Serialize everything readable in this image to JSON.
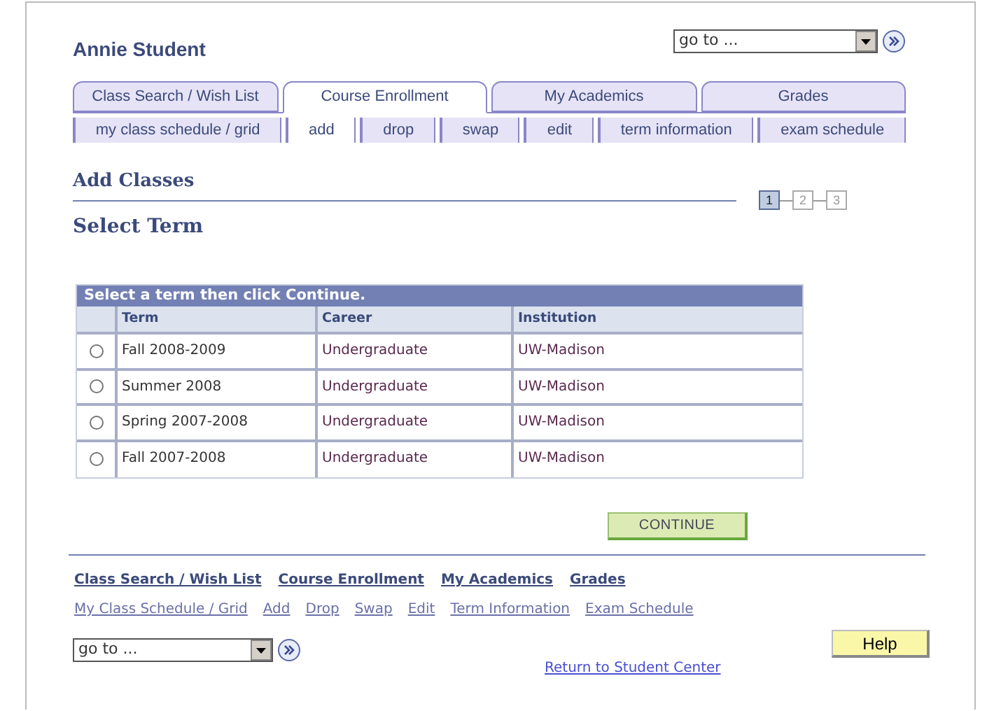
{
  "user_name": "Annie Student",
  "goto_top": {
    "value": "go to ..."
  },
  "tabs": [
    {
      "label": "Class Search / Wish List",
      "selected": false
    },
    {
      "label": "Course Enrollment",
      "selected": true
    },
    {
      "label": "My Academics",
      "selected": false
    },
    {
      "label": "Grades",
      "selected": false
    }
  ],
  "subtabs": [
    {
      "label": "my class schedule / grid",
      "selected": false
    },
    {
      "label": "add",
      "selected": true
    },
    {
      "label": "drop",
      "selected": false
    },
    {
      "label": "swap",
      "selected": false
    },
    {
      "label": "edit",
      "selected": false
    },
    {
      "label": "term information",
      "selected": false
    },
    {
      "label": "exam schedule",
      "selected": false
    }
  ],
  "page_title": "Add Classes",
  "steps": [
    {
      "label": "1",
      "selected": true
    },
    {
      "label": "2",
      "selected": false
    },
    {
      "label": "3",
      "selected": false
    }
  ],
  "section_title": "Select Term",
  "table": {
    "caption": "Select a term then click Continue.",
    "columns": [
      "Term",
      "Career",
      "Institution"
    ],
    "rows": [
      {
        "selected": false,
        "cells": [
          "Fall 2008-2009",
          "Undergraduate",
          "UW-Madison"
        ]
      },
      {
        "selected": false,
        "cells": [
          "Summer 2008",
          "Undergraduate",
          "UW-Madison"
        ]
      },
      {
        "selected": false,
        "cells": [
          "Spring 2007-2008",
          "Undergraduate",
          "UW-Madison"
        ]
      },
      {
        "selected": false,
        "cells": [
          "Fall 2007-2008",
          "Undergraduate",
          "UW-Madison"
        ]
      }
    ]
  },
  "continue_button": "CONTINUE",
  "footer_links": [
    "Class Search / Wish List",
    "Course Enrollment",
    "My Academics",
    "Grades"
  ],
  "footer_sublinks": [
    "My Class Schedule / Grid",
    "Add",
    "Drop",
    "Swap",
    "Edit",
    "Term Information",
    "Exam Schedule"
  ],
  "goto_bottom": {
    "value": "go to ..."
  },
  "help_button": "Help",
  "return_link": "Return to Student Center"
}
